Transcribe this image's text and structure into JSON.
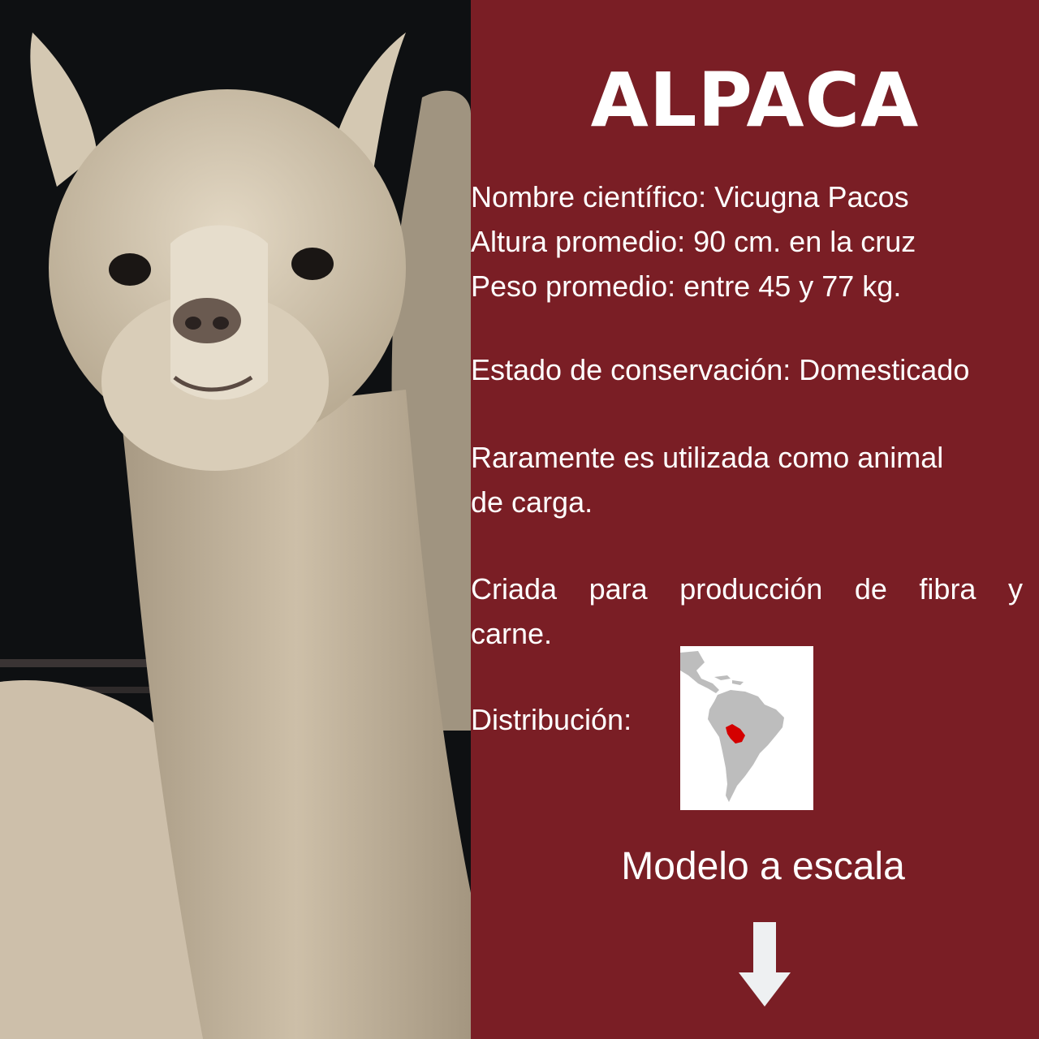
{
  "title": "ALPACA",
  "facts": {
    "scientific_name": "Nombre científico: Vicugna Pacos",
    "height": "Altura promedio: 90 cm. en la cruz",
    "weight": "Peso promedio: entre 45 y 77 kg."
  },
  "conservation": "Estado de conservación: Domesticado",
  "usage": {
    "line1": "Raramente es utilizada como animal",
    "line2": "de carga."
  },
  "breeding": {
    "words": [
      "Criada",
      "para",
      "producción",
      "de",
      "fibra",
      "y"
    ],
    "line2": "carne."
  },
  "distribution_label": "Distribución:",
  "scale_model_label": "Modelo a escala",
  "colors": {
    "background": "#7a1e25",
    "text": "#ffffff",
    "map_highlight": "#d40000"
  },
  "icons": {
    "arrow": "arrow-down-icon",
    "map": "south-america-map"
  }
}
